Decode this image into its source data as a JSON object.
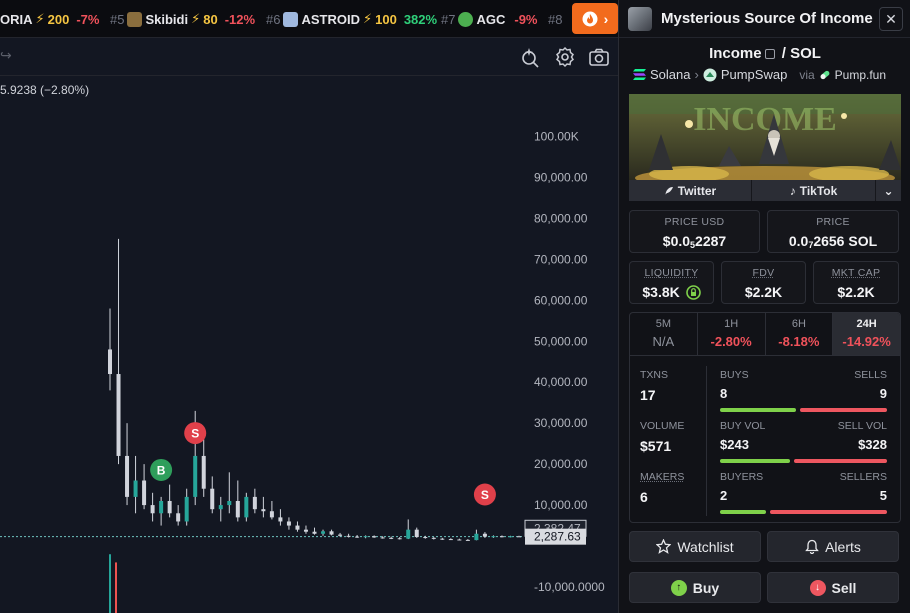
{
  "ticker": {
    "items": [
      {
        "rank": "",
        "name": "ORIA",
        "score": "200",
        "change": "-7%",
        "dir": "neg",
        "color": ""
      },
      {
        "rank": "#5",
        "name": "Skibidi",
        "score": "80",
        "change": "-12%",
        "dir": "neg",
        "color": "#8a6e3e"
      },
      {
        "rank": "#6",
        "name": "ASTROID",
        "score": "100",
        "change": "382%",
        "dir": "pos",
        "color": "#9fb8de"
      },
      {
        "rank": "#7",
        "name": "AGC",
        "score": "",
        "change": "-9%",
        "dir": "neg",
        "color": "#4caf50"
      },
      {
        "rank": "#8",
        "name": "",
        "score": "",
        "change": "",
        "dir": "neg",
        "color": ""
      }
    ]
  },
  "chart": {
    "ohlc_text": "5.9238 (−2.80%)",
    "y_ticks": [
      "100.00K",
      "90,000.00",
      "80,000.00",
      "70,000.00",
      "60,000.00",
      "50,000.00",
      "40,000.00",
      "30,000.00",
      "20,000.00",
      "10,000.00",
      "0.00",
      "-10,000.0000"
    ],
    "price_tag_high": "2,382.47",
    "price_tag_current": "2,287.63",
    "markers": [
      {
        "label": "S",
        "kind": "sell"
      },
      {
        "label": "B",
        "kind": "buy"
      },
      {
        "label": "S",
        "kind": "sell"
      }
    ],
    "colors": {
      "up": "#26a69a",
      "down": "#ef5350",
      "wick": "#d1d4dc",
      "buy": "#2e9e5b",
      "sell": "#e0404a"
    }
  },
  "chart_data": {
    "type": "candlestick",
    "title": "",
    "ylabel": "",
    "ylim": [
      -10000,
      105000
    ],
    "last_close": 2287.63,
    "prev_high": 2382.47,
    "candles": [
      [
        48000,
        58000,
        38000,
        42000
      ],
      [
        42000,
        75000,
        20000,
        22000
      ],
      [
        22000,
        30000,
        10000,
        12000
      ],
      [
        12000,
        22000,
        8000,
        16000
      ],
      [
        16000,
        20000,
        9000,
        10000
      ],
      [
        10000,
        13000,
        6000,
        8000
      ],
      [
        8000,
        12000,
        5000,
        11000
      ],
      [
        11000,
        15000,
        7000,
        8000
      ],
      [
        8000,
        10000,
        5000,
        6000
      ],
      [
        6000,
        14000,
        5000,
        12000
      ],
      [
        12000,
        33000,
        10000,
        22000
      ],
      [
        22000,
        26000,
        12000,
        14000
      ],
      [
        14000,
        17000,
        8000,
        9000
      ],
      [
        9000,
        12000,
        6000,
        10000
      ],
      [
        10000,
        18000,
        8000,
        11000
      ],
      [
        11000,
        16000,
        6000,
        7000
      ],
      [
        7000,
        13000,
        6000,
        12000
      ],
      [
        12000,
        14000,
        8000,
        9000
      ],
      [
        9000,
        12000,
        7000,
        8500
      ],
      [
        8500,
        11000,
        6500,
        7000
      ],
      [
        7000,
        9000,
        5000,
        6000
      ],
      [
        6000,
        7000,
        4000,
        5000
      ],
      [
        5000,
        6000,
        3500,
        4000
      ],
      [
        4000,
        5000,
        3000,
        3500
      ],
      [
        3500,
        4500,
        2800,
        3000
      ],
      [
        3000,
        4000,
        2500,
        3600
      ],
      [
        3600,
        4000,
        2600,
        2800
      ],
      [
        2800,
        3200,
        2300,
        2500
      ],
      [
        2500,
        3000,
        2100,
        2300
      ],
      [
        2300,
        2700,
        2000,
        2200
      ],
      [
        2200,
        2600,
        1900,
        2400
      ],
      [
        2400,
        2600,
        2000,
        2100
      ],
      [
        2100,
        2400,
        1800,
        2000
      ],
      [
        2000,
        2300,
        1700,
        1900
      ],
      [
        1900,
        2200,
        1600,
        1800
      ],
      [
        1800,
        6500,
        1700,
        4000
      ],
      [
        4000,
        4500,
        2000,
        2200
      ],
      [
        2200,
        2500,
        1800,
        2000
      ],
      [
        2000,
        2200,
        1600,
        1800
      ],
      [
        1800,
        2000,
        1500,
        1700
      ],
      [
        1700,
        1900,
        1500,
        1600
      ],
      [
        1600,
        1800,
        1400,
        1500
      ],
      [
        1500,
        1700,
        1300,
        1450
      ],
      [
        1450,
        4000,
        1400,
        3000
      ],
      [
        3000,
        3400,
        2000,
        2300
      ],
      [
        2300,
        2600,
        2000,
        2400
      ],
      [
        2400,
        2600,
        2100,
        2250
      ],
      [
        2250,
        2500,
        2100,
        2382
      ],
      [
        2382,
        2500,
        2200,
        2288
      ]
    ]
  },
  "panel": {
    "token_name": "Mysterious Source Of Income",
    "pair_base": "Income",
    "pair_sep": "/",
    "pair_quote": "SOL",
    "chain": "Solana",
    "dex": "PumpSwap",
    "via": "via",
    "launchpad": "Pump.fun",
    "banner_text": "INCOME",
    "social": {
      "twitter": "Twitter",
      "tiktok": "TikTok"
    },
    "price_usd": {
      "label": "PRICE USD",
      "prefix": "$0.0",
      "zeros": "5",
      "digits": "2287"
    },
    "price_sol": {
      "label": "PRICE",
      "prefix": "0.0",
      "zeros": "7",
      "digits": "2656 SOL"
    },
    "liquidity": {
      "label": "LIQUIDITY",
      "value": "$3.8K"
    },
    "fdv": {
      "label": "FDV",
      "value": "$2.2K"
    },
    "mktcap": {
      "label": "MKT CAP",
      "value": "$2.2K"
    },
    "timeframes": [
      {
        "label": "5M",
        "value": "N/A",
        "dir": "na"
      },
      {
        "label": "1H",
        "value": "-2.80%",
        "dir": "neg"
      },
      {
        "label": "6H",
        "value": "-8.18%",
        "dir": "neg"
      },
      {
        "label": "24H",
        "value": "-14.92%",
        "dir": "neg"
      }
    ],
    "stats": {
      "txns": {
        "label": "TXNS",
        "value": "17"
      },
      "volume": {
        "label": "VOLUME",
        "value": "$571"
      },
      "makers": {
        "label": "MAKERS",
        "value": "6"
      },
      "buys": {
        "label": "BUYS",
        "value": "8"
      },
      "sells": {
        "label": "SELLS",
        "value": "9"
      },
      "buy_vol": {
        "label": "BUY VOL",
        "value": "$243"
      },
      "sell_vol": {
        "label": "SELL VOL",
        "value": "$328"
      },
      "buyers": {
        "label": "BUYERS",
        "value": "2"
      },
      "sellers": {
        "label": "SELLERS",
        "value": "5"
      },
      "buy_share": 0.47,
      "buy_vol_share": 0.43,
      "buyer_share": 0.29
    },
    "watchlist_label": "Watchlist",
    "alerts_label": "Alerts",
    "buy_label": "Buy",
    "sell_label": "Sell"
  }
}
